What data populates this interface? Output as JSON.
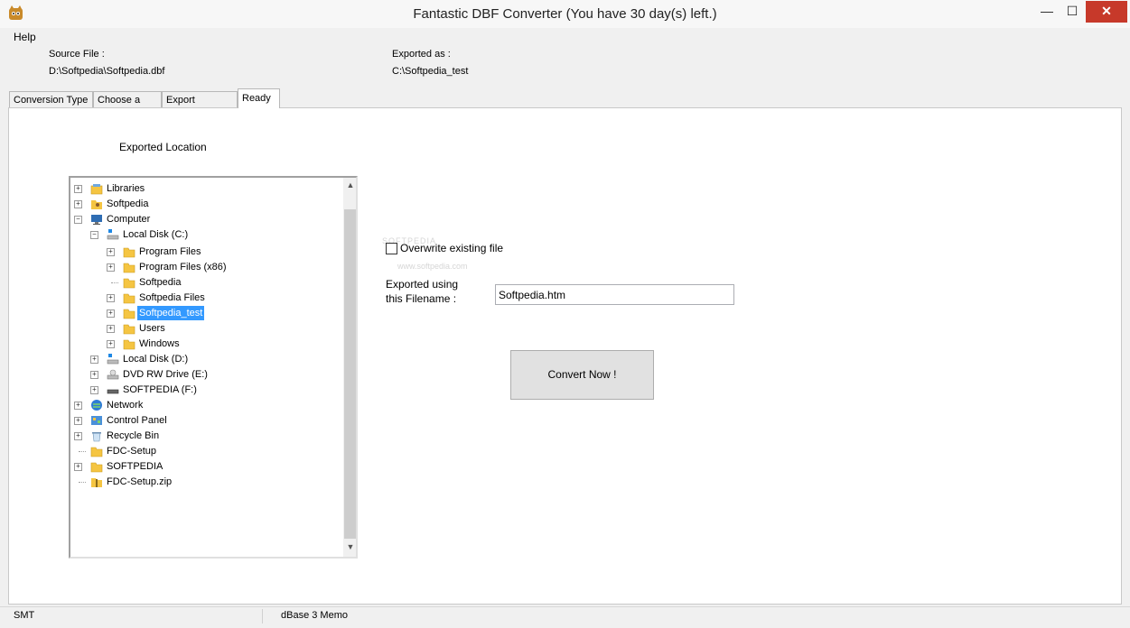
{
  "window": {
    "title": "Fantastic DBF Converter  (You have 30 day(s) left.)",
    "minimize": "—",
    "maximize": "☐",
    "close": "✕"
  },
  "menu": {
    "help": "Help"
  },
  "info": {
    "source_label": "Source File :",
    "source_value": "D:\\Softpedia\\Softpedia.dbf",
    "export_label": "Exported as :",
    "export_value": "C:\\Softpedia_test"
  },
  "tabs": [
    {
      "label": "Conversion Type"
    },
    {
      "label": "Choose a File"
    },
    {
      "label": "Export Settings"
    },
    {
      "label": "Ready",
      "active": true
    }
  ],
  "panel": {
    "location_heading": "Exported  Location",
    "overwrite_label": "Overwrite existing file",
    "overwrite_checked": false,
    "filename_label_1": "Exported using",
    "filename_label_2": "this Filename :",
    "filename_value": "Softpedia.htm",
    "convert_button": "Convert Now !"
  },
  "tree": {
    "nodes": [
      {
        "label": "Libraries",
        "icon": "libraries-icon"
      },
      {
        "label": "Softpedia",
        "icon": "user-folder-icon"
      },
      {
        "label": "Computer",
        "icon": "computer-icon"
      },
      {
        "label": "Local Disk (C:)",
        "icon": "drive-icon"
      },
      {
        "label": "Program Files",
        "icon": "folder-icon"
      },
      {
        "label": "Program Files (x86)",
        "icon": "folder-icon"
      },
      {
        "label": "Softpedia",
        "icon": "folder-icon"
      },
      {
        "label": "Softpedia Files",
        "icon": "folder-icon"
      },
      {
        "label": "Softpedia_test",
        "icon": "folder-icon",
        "selected": true
      },
      {
        "label": "Users",
        "icon": "folder-icon"
      },
      {
        "label": "Windows",
        "icon": "folder-icon"
      },
      {
        "label": "Local Disk (D:)",
        "icon": "drive-icon"
      },
      {
        "label": "DVD RW Drive (E:)",
        "icon": "dvd-drive-icon"
      },
      {
        "label": "SOFTPEDIA (F:)",
        "icon": "usb-drive-icon"
      },
      {
        "label": "Network",
        "icon": "network-icon"
      },
      {
        "label": "Control Panel",
        "icon": "control-panel-icon"
      },
      {
        "label": "Recycle Bin",
        "icon": "recycle-bin-icon"
      },
      {
        "label": "FDC-Setup",
        "icon": "folder-icon"
      },
      {
        "label": "SOFTPEDIA",
        "icon": "folder-icon"
      },
      {
        "label": "FDC-Setup.zip",
        "icon": "zip-icon"
      }
    ]
  },
  "status": {
    "left": "SMT",
    "middle": "dBase 3 Memo"
  },
  "watermark": {
    "line1": "SOFTPEDIA",
    "line2": "www.softpedia.com"
  },
  "colors": {
    "selection": "#3399ff",
    "close_button": "#c7392a",
    "folder": "#f5c542"
  }
}
